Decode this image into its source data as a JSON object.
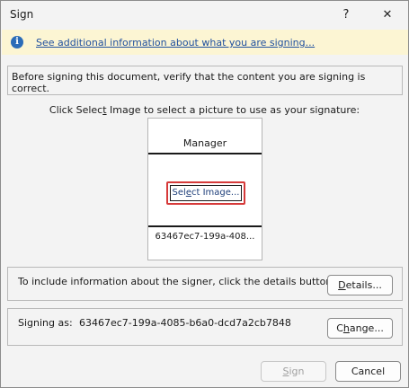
{
  "window": {
    "title": "Sign",
    "help_glyph": "?",
    "close_glyph": "✕"
  },
  "infobar": {
    "icon": "info-icon",
    "icon_glyph": "i",
    "link_text": "See additional information about what you are signing..."
  },
  "verify_text": "Before signing this document, verify that the content you are signing is correct.",
  "instruction": {
    "before": "Click Selec",
    "accel": "t",
    "after": " Image to select a picture to use as your signature:"
  },
  "signature": {
    "name": "Manager",
    "select_button": {
      "before": "Sel",
      "accel": "e",
      "after": "ct Image..."
    },
    "id_truncated": "63467ec7-199a-408..."
  },
  "details": {
    "text": "To include information about the signer, click the details button.",
    "button": {
      "accel": "D",
      "after": "etails..."
    }
  },
  "signing": {
    "label": "Signing as:",
    "value": "63467ec7-199a-4085-b6a0-dcd7a2cb7848",
    "button": {
      "before": "C",
      "accel": "h",
      "after": "ange..."
    }
  },
  "footer": {
    "sign_button": {
      "accel": "S",
      "after": "ign"
    },
    "cancel_label": "Cancel"
  }
}
